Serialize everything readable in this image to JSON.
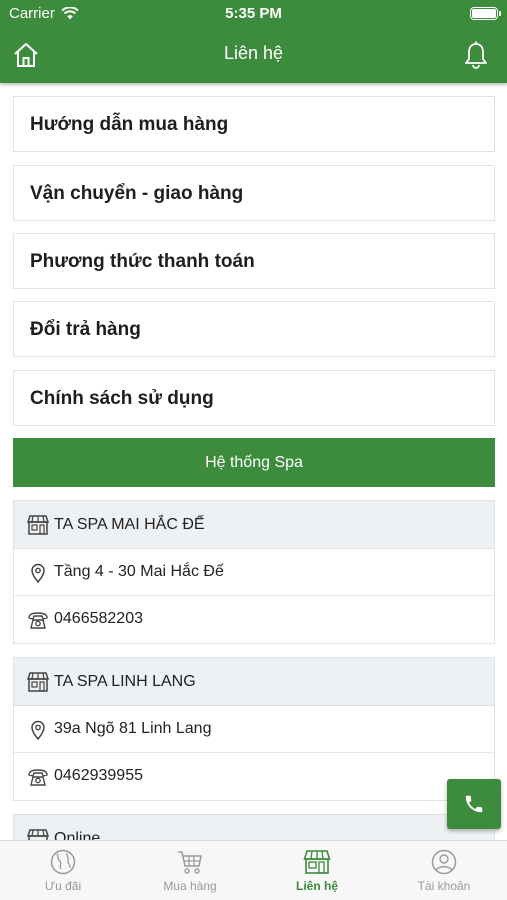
{
  "status_bar": {
    "carrier": "Carrier",
    "time": "5:35 PM"
  },
  "nav": {
    "title": "Liên hệ",
    "home_icon": "home-icon",
    "bell_icon": "bell-icon"
  },
  "menu": [
    {
      "label": "Hướng dẫn mua hàng"
    },
    {
      "label": "Vận chuyển - giao hàng"
    },
    {
      "label": "Phương thức thanh toán"
    },
    {
      "label": "Đổi trả hàng"
    },
    {
      "label": "Chính sách sử dụng"
    }
  ],
  "spa_section": {
    "title": "Hệ thống Spa",
    "spas": [
      {
        "name": "TA SPA MAI HẮC ĐẾ",
        "address": "Tầng 4 - 30 Mai Hắc Đế",
        "phone": "0466582203"
      },
      {
        "name": "TA SPA LINH LANG",
        "address": "39a Ngõ 81 Linh Lang",
        "phone": "0462939955"
      },
      {
        "name": "Online"
      }
    ]
  },
  "tabs": [
    {
      "label": "Ưu đãi",
      "icon": "globe-icon",
      "active": false
    },
    {
      "label": "Mua hàng",
      "icon": "cart-icon",
      "active": false
    },
    {
      "label": "Liên hệ",
      "icon": "store-icon",
      "active": true
    },
    {
      "label": "Tài khoản",
      "icon": "user-icon",
      "active": false
    }
  ],
  "colors": {
    "primary": "#3d8b3d",
    "card_header": "#eef1f4",
    "tab_inactive": "#999999"
  }
}
